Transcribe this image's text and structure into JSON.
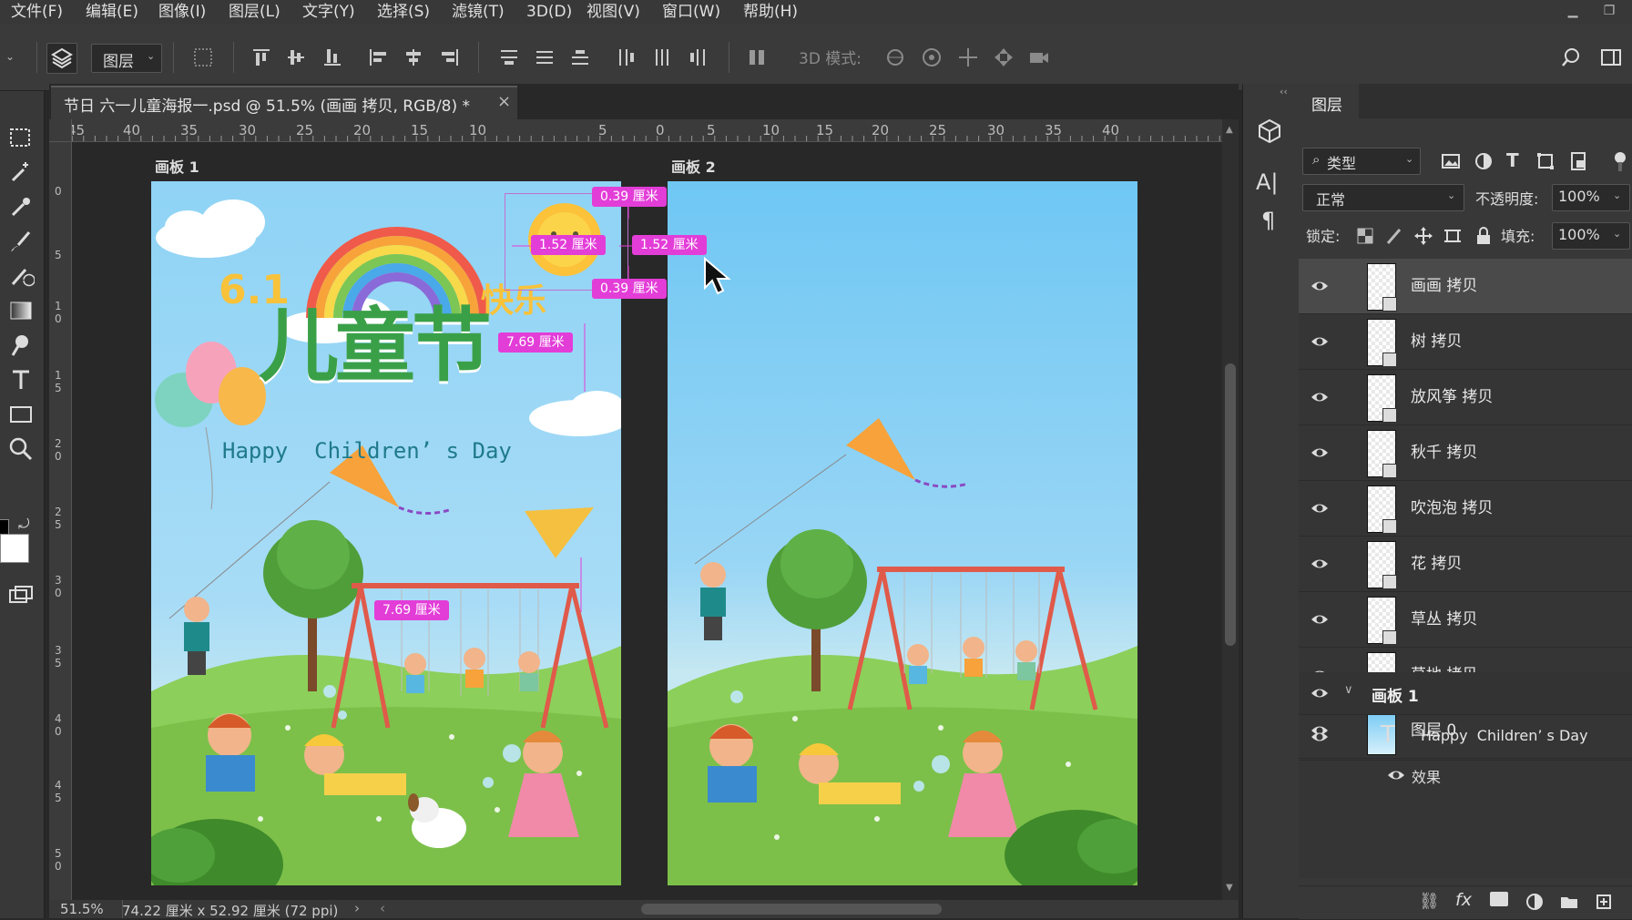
{
  "menu": [
    "文件(F)",
    "编辑(E)",
    "图像(I)",
    "图层(L)",
    "文字(Y)",
    "选择(S)",
    "滤镜(T)",
    "3D(D)",
    "视图(V)",
    "窗口(W)",
    "帮助(H)"
  ],
  "options": {
    "target_select": "图层",
    "mode_3d_label": "3D 模式:"
  },
  "document": {
    "tab_title": "节日 六一儿童海报一.psd @ 51.5% (画画 拷贝, RGB/8) *",
    "close_symbol": "×"
  },
  "ruler": {
    "top": [
      "45",
      "40",
      "35",
      "30",
      "25",
      "20",
      "15",
      "10",
      "5",
      "0",
      "5",
      "10",
      "15",
      "20",
      "25",
      "30",
      "35",
      "40"
    ],
    "left": [
      "0",
      "5",
      "1\n0",
      "1\n5",
      "2\n0",
      "2\n5",
      "3\n0",
      "3\n5",
      "4\n0",
      "4\n5",
      "5\n0"
    ]
  },
  "artboards": [
    {
      "label": "画板 1"
    },
    {
      "label": "画板 2"
    }
  ],
  "poster": {
    "number": "6.1",
    "title_right": "快乐",
    "title_main": "儿童节",
    "subtitle": "Happy  Children’ s Day"
  },
  "measurements": [
    "0.39 厘米",
    "1.52 厘米",
    "1.52 厘米",
    "0.39 厘米",
    "7.69 厘米",
    "7.69 厘米"
  ],
  "status": {
    "zoom": "51.5%",
    "doc_info": "74.22 厘米 x 52.92 厘米 (72 ppi)"
  },
  "layers_panel": {
    "tab": "图层",
    "filter_kind": "类型",
    "blend_mode": "正常",
    "opacity_label": "不透明度:",
    "opacity_value": "100%",
    "lock_label": "锁定:",
    "fill_label": "填充:",
    "fill_value": "100%",
    "layers": [
      {
        "name": "画画 拷贝",
        "selected": true
      },
      {
        "name": "树 拷贝"
      },
      {
        "name": "放风筝 拷贝"
      },
      {
        "name": "秋千 拷贝"
      },
      {
        "name": "吹泡泡 拷贝"
      },
      {
        "name": "花 拷贝"
      },
      {
        "name": "草丛 拷贝"
      },
      {
        "name": "草地 拷贝"
      },
      {
        "name": "图层 0"
      }
    ],
    "group": {
      "name": "画板 1"
    },
    "text_layer": {
      "name": "Happy  Children’ s Day"
    },
    "effects_label": "效果"
  },
  "colors": {
    "accent_pill": "#e33dd8",
    "sky": "#8ed4f5",
    "grass": "#7cc04a"
  }
}
